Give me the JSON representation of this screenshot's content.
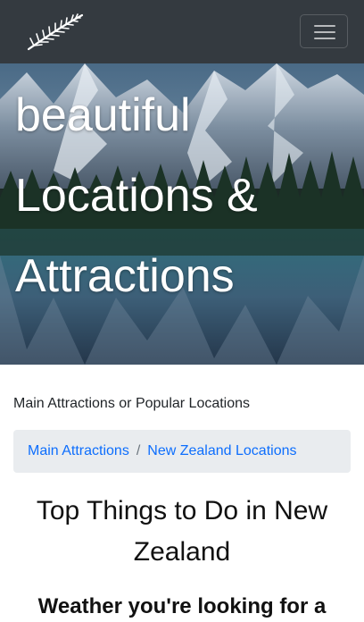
{
  "navbar": {
    "logo_icon": "silver-fern-icon",
    "toggler_icon": "hamburger-menu-icon",
    "background": "#343a40"
  },
  "hero": {
    "title_lines": [
      "beautiful",
      "Locations &",
      "Attractions"
    ],
    "image": "mountain-lake-reflection"
  },
  "section_label": "Main Attractions or Popular Locations",
  "breadcrumb": {
    "items": [
      "Main Attractions",
      "New Zealand Locations"
    ],
    "separator": "/"
  },
  "main": {
    "heading": "Top Things to Do in New Zealand",
    "subheading": "Weather you're looking for a"
  },
  "colors": {
    "link": "#0d6efd",
    "breadcrumb_bg": "#e9ecef"
  }
}
